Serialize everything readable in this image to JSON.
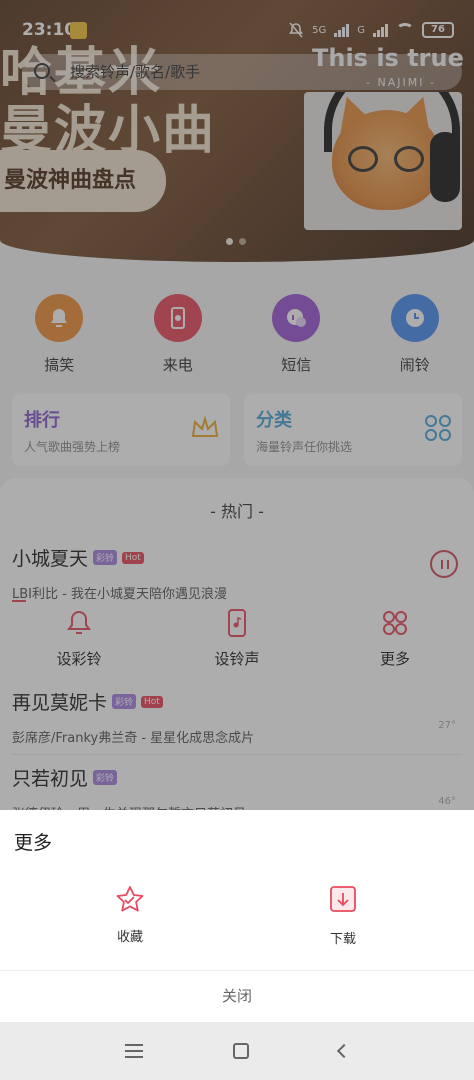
{
  "status_bar": {
    "time": "23:10",
    "network": "5G",
    "network2": "G",
    "battery": "76"
  },
  "search": {
    "placeholder": "搜索铃声/歌名/歌手"
  },
  "banner": {
    "line1": "哈基米",
    "line2": "曼波小曲",
    "pill": "曼波神曲盘点",
    "english": "This is true music",
    "subtitle": "- NAJIMI -"
  },
  "categories": [
    {
      "label": "搞笑",
      "color": "#f0903a"
    },
    {
      "label": "来电",
      "color": "#e84a5f"
    },
    {
      "label": "短信",
      "color": "#9b59d6"
    },
    {
      "label": "闹铃",
      "color": "#4d8ef0"
    }
  ],
  "cards": [
    {
      "title": "排行",
      "subtitle": "人气歌曲强势上榜"
    },
    {
      "title": "分类",
      "subtitle": "海量铃声任你挑选"
    }
  ],
  "hot": {
    "title": "- 热门 -",
    "tag_cl": "彩铃",
    "tag_hot": "Hot",
    "songs": [
      {
        "name": "小城夏天",
        "desc": "LBI利比 - 我在小城夏天陪你遇见浪漫"
      },
      {
        "name": "再见莫妮卡",
        "desc": "彭席彦/Franky弗兰奇 - 星星化成思念成片",
        "count": "27°"
      },
      {
        "name": "只若初见",
        "desc": "张德伊玲 - 用一生兑现那句誓言只若初见",
        "count": "46°"
      }
    ],
    "actions": [
      {
        "label": "设彩铃"
      },
      {
        "label": "设铃声"
      },
      {
        "label": "更多"
      }
    ]
  },
  "sheet": {
    "title": "更多",
    "options": [
      {
        "label": "收藏"
      },
      {
        "label": "下载"
      }
    ],
    "close": "关闭"
  },
  "colors": {
    "accent": "#e84a5f",
    "purple": "#8a5bd0",
    "blue": "#4aa4d6"
  }
}
